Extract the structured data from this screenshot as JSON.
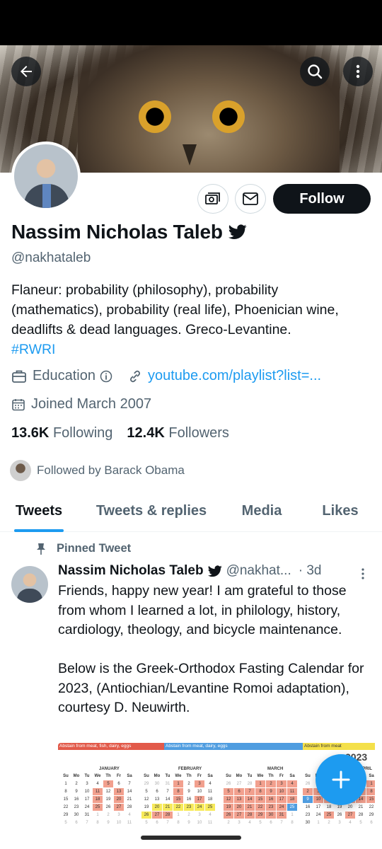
{
  "profile": {
    "name": "Nassim Nicholas Taleb",
    "handle": "@nakhataleb",
    "bio_text": "Flaneur: probability (philosophy), probability (mathematics), probability (real life), Phoenician wine, deadlifts & dead languages. Greco-Levantine.",
    "bio_hashtag": "#RWRI",
    "category": "Education",
    "link": "youtube.com/playlist?list=...",
    "joined": "Joined March 2007",
    "following_count": "13.6K",
    "following_label": "Following",
    "followers_count": "12.4K",
    "followers_label": "Followers",
    "followed_by": "Followed by Barack Obama"
  },
  "actions": {
    "follow_label": "Follow"
  },
  "icons": {
    "back": "arrow-left-icon",
    "search": "search-icon",
    "more": "more-vertical-icon",
    "money": "money-icon",
    "mail": "mail-icon",
    "verified": "twitter-bird-icon",
    "category": "briefcase-icon",
    "info": "info-icon",
    "link": "link-icon",
    "calendar": "calendar-icon",
    "pin": "pin-icon",
    "compose": "plus-icon"
  },
  "tabs": [
    {
      "label": "Tweets",
      "active": true
    },
    {
      "label": "Tweets & replies",
      "active": false
    },
    {
      "label": "Media",
      "active": false
    },
    {
      "label": "Likes",
      "active": false
    }
  ],
  "pinned_tweet": {
    "label": "Pinned Tweet",
    "author_name": "Nassim Nicholas Taleb",
    "author_handle": "@nakhat...",
    "time": "· 3d",
    "paragraph1": "Friends, happy new year! I am grateful to those from whom I learned a lot, in philology, history, cardiology, theology, and bicycle maintenance.",
    "paragraph2": "Below is the Greek-Orthodox Fasting Calendar for 2023, (Antiochian/Levantine Romoi adaptation), courtesy D. Neuwirth.",
    "image": {
      "band1": "Abstain from meat, fish, dairy, eggs",
      "band2": "Abstain from meat, dairy, eggs",
      "band3": "Abstain from meat",
      "year": "2023",
      "months": [
        "JANUARY",
        "FEBRUARY",
        "MARCH",
        "APRIL"
      ]
    }
  },
  "colors": {
    "accent": "#1d9bf0",
    "text": "#0f1419",
    "secondary": "#536471",
    "follow_bg": "#0f1419"
  }
}
